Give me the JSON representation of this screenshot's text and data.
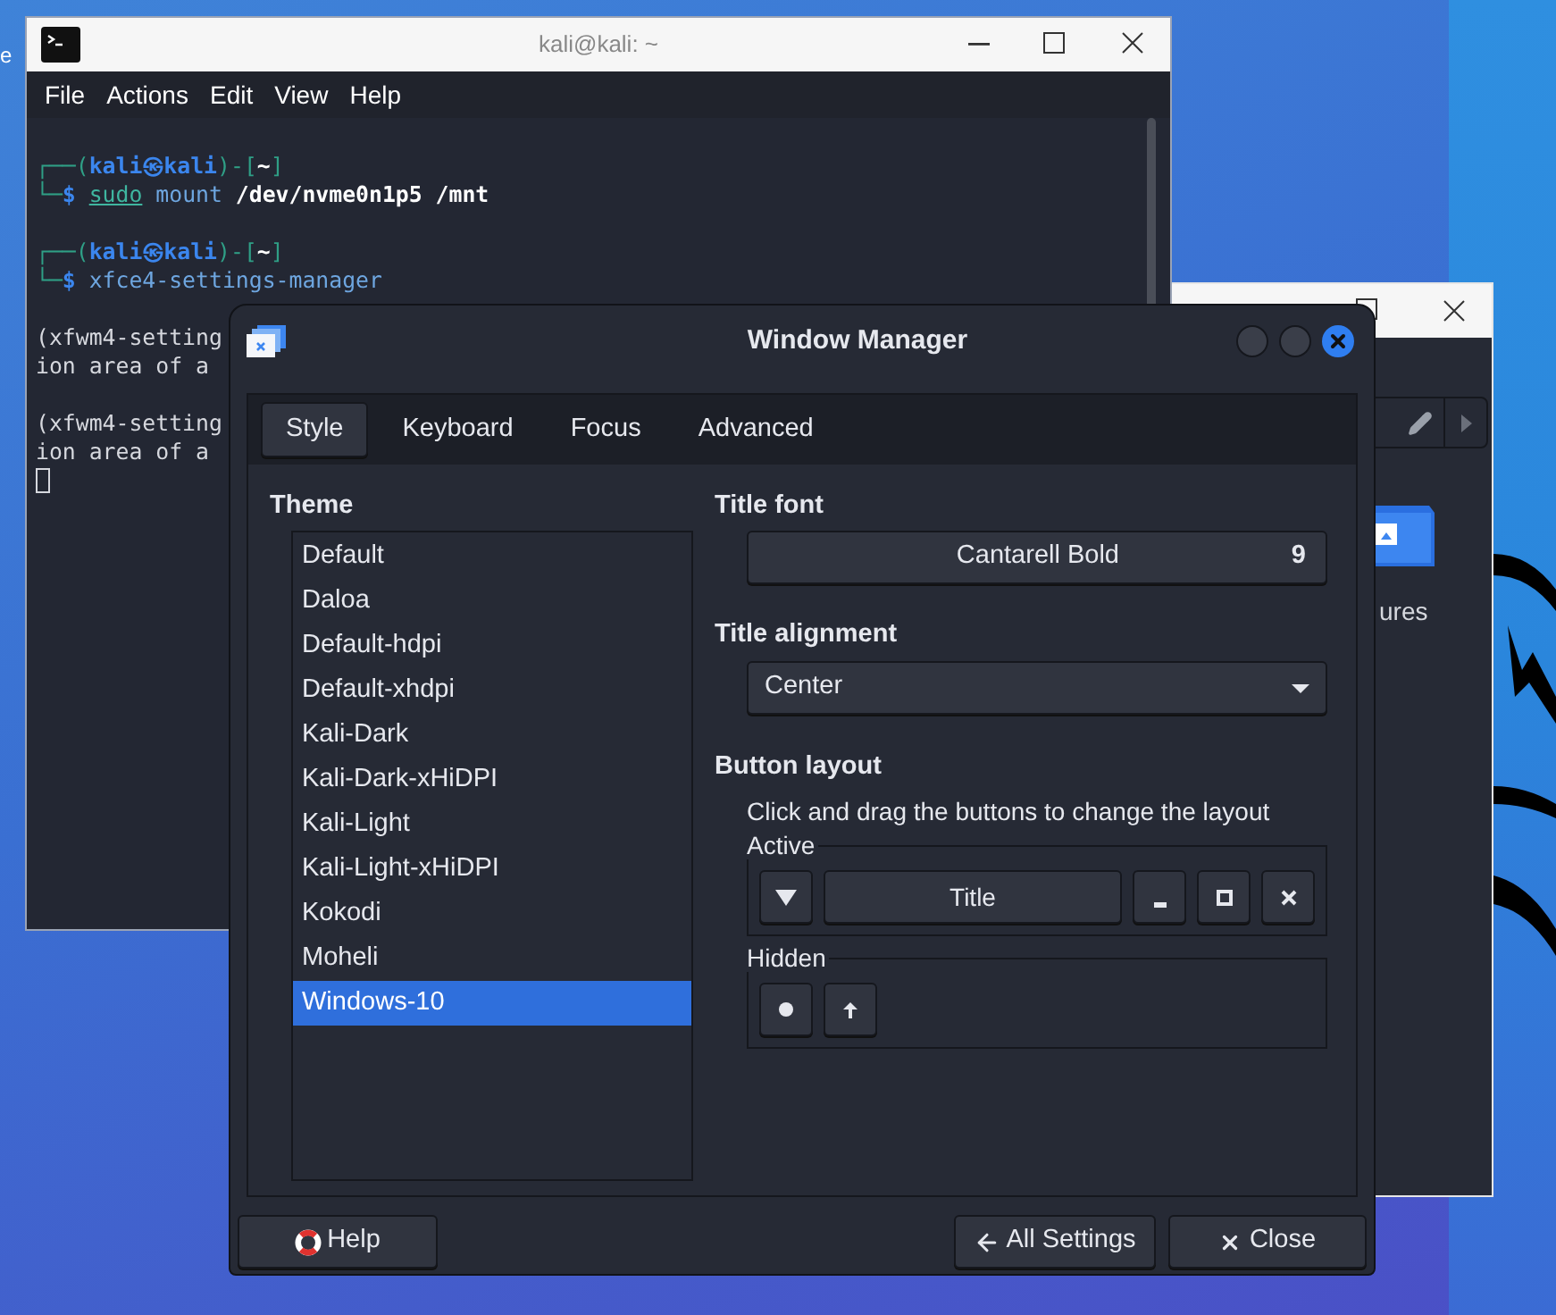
{
  "desktop": {
    "icon_label": "e"
  },
  "terminal": {
    "title": "kali@kali: ~",
    "menu": [
      "File",
      "Actions",
      "Edit",
      "View",
      "Help"
    ],
    "blocks": [
      [
        {
          "segments": [
            {
              "text": "┌──(",
              "kind": "frame"
            },
            {
              "text": "kali㉿kali",
              "kind": "user"
            },
            {
              "text": ")-[",
              "kind": "frame"
            },
            {
              "text": "~",
              "kind": "path"
            },
            {
              "text": "]",
              "kind": "frame"
            }
          ]
        },
        {
          "segments": [
            {
              "text": "└─",
              "kind": "frame"
            },
            {
              "text": "$ ",
              "kind": "user"
            },
            {
              "text": "sudo",
              "kind": "command_found"
            },
            {
              "text": " mount ",
              "kind": "command"
            },
            {
              "text": "/dev/nvme0n1p5 /mnt",
              "kind": "path"
            }
          ]
        }
      ],
      [
        {
          "segments": [
            {
              "text": "┌──(",
              "kind": "frame"
            },
            {
              "text": "kali㉿kali",
              "kind": "user"
            },
            {
              "text": ")-[",
              "kind": "frame"
            },
            {
              "text": "~",
              "kind": "path"
            },
            {
              "text": "]",
              "kind": "frame"
            }
          ]
        },
        {
          "segments": [
            {
              "text": "└─",
              "kind": "frame"
            },
            {
              "text": "$ ",
              "kind": "user"
            },
            {
              "text": "xfce4-settings-manager",
              "kind": "command"
            }
          ]
        }
      ],
      [
        {
          "segments": [
            {
              "text": "(xfwm4-setting",
              "kind": "plain"
            }
          ]
        },
        {
          "segments": [
            {
              "text": "ion area of a",
              "kind": "plain"
            }
          ]
        }
      ],
      [
        {
          "segments": [
            {
              "text": "(xfwm4-setting",
              "kind": "plain"
            }
          ]
        },
        {
          "segments": [
            {
              "text": "ion area of a",
              "kind": "plain"
            }
          ]
        }
      ]
    ],
    "cursor": true
  },
  "back_window": {
    "label": "ures"
  },
  "dialog": {
    "title": "Window Manager",
    "tabs": [
      {
        "label": "Style",
        "selected": true
      },
      {
        "label": "Keyboard",
        "selected": false
      },
      {
        "label": "Focus",
        "selected": false
      },
      {
        "label": "Advanced",
        "selected": false
      }
    ],
    "theme": {
      "label": "Theme",
      "items": [
        {
          "label": "Default",
          "selected": false
        },
        {
          "label": "Daloa",
          "selected": false
        },
        {
          "label": "Default-hdpi",
          "selected": false
        },
        {
          "label": "Default-xhdpi",
          "selected": false
        },
        {
          "label": "Kali-Dark",
          "selected": false
        },
        {
          "label": "Kali-Dark-xHiDPI",
          "selected": false
        },
        {
          "label": "Kali-Light",
          "selected": false
        },
        {
          "label": "Kali-Light-xHiDPI",
          "selected": false
        },
        {
          "label": "Kokodi",
          "selected": false
        },
        {
          "label": "Moheli",
          "selected": false
        },
        {
          "label": "Windows-10",
          "selected": true
        }
      ]
    },
    "title_font": {
      "label": "Title font",
      "font": "Cantarell Bold",
      "size": "9"
    },
    "title_alignment": {
      "label": "Title alignment",
      "value": "Center"
    },
    "button_layout": {
      "label": "Button layout",
      "hint": "Click and drag the buttons to change the layout",
      "active": {
        "label": "Active",
        "buttons": [
          {
            "kind": "menu"
          },
          {
            "kind": "title",
            "label": "Title"
          },
          {
            "kind": "minimize"
          },
          {
            "kind": "maximize"
          },
          {
            "kind": "close"
          }
        ]
      },
      "hidden": {
        "label": "Hidden",
        "buttons": [
          {
            "kind": "stick"
          },
          {
            "kind": "shade"
          }
        ]
      }
    },
    "footer": {
      "help": "Help",
      "all_settings": "All Settings",
      "close": "Close"
    }
  }
}
